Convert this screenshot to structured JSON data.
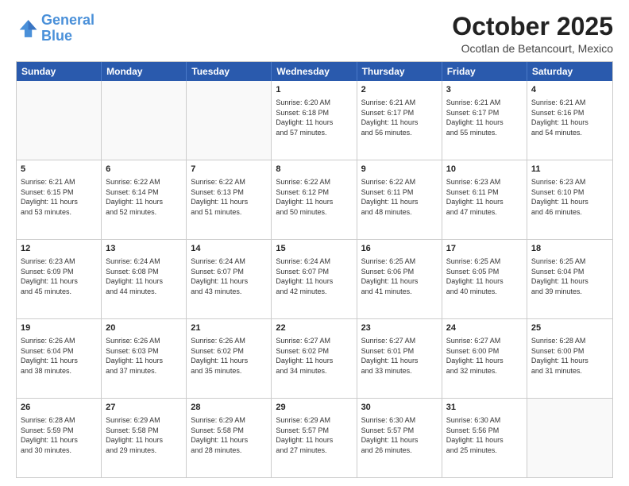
{
  "header": {
    "logo": {
      "line1": "General",
      "line2": "Blue"
    },
    "title": "October 2025",
    "subtitle": "Ocotlan de Betancourt, Mexico"
  },
  "weekdays": [
    "Sunday",
    "Monday",
    "Tuesday",
    "Wednesday",
    "Thursday",
    "Friday",
    "Saturday"
  ],
  "rows": [
    [
      {
        "day": "",
        "info": ""
      },
      {
        "day": "",
        "info": ""
      },
      {
        "day": "",
        "info": ""
      },
      {
        "day": "1",
        "info": "Sunrise: 6:20 AM\nSunset: 6:18 PM\nDaylight: 11 hours\nand 57 minutes."
      },
      {
        "day": "2",
        "info": "Sunrise: 6:21 AM\nSunset: 6:17 PM\nDaylight: 11 hours\nand 56 minutes."
      },
      {
        "day": "3",
        "info": "Sunrise: 6:21 AM\nSunset: 6:17 PM\nDaylight: 11 hours\nand 55 minutes."
      },
      {
        "day": "4",
        "info": "Sunrise: 6:21 AM\nSunset: 6:16 PM\nDaylight: 11 hours\nand 54 minutes."
      }
    ],
    [
      {
        "day": "5",
        "info": "Sunrise: 6:21 AM\nSunset: 6:15 PM\nDaylight: 11 hours\nand 53 minutes."
      },
      {
        "day": "6",
        "info": "Sunrise: 6:22 AM\nSunset: 6:14 PM\nDaylight: 11 hours\nand 52 minutes."
      },
      {
        "day": "7",
        "info": "Sunrise: 6:22 AM\nSunset: 6:13 PM\nDaylight: 11 hours\nand 51 minutes."
      },
      {
        "day": "8",
        "info": "Sunrise: 6:22 AM\nSunset: 6:12 PM\nDaylight: 11 hours\nand 50 minutes."
      },
      {
        "day": "9",
        "info": "Sunrise: 6:22 AM\nSunset: 6:11 PM\nDaylight: 11 hours\nand 48 minutes."
      },
      {
        "day": "10",
        "info": "Sunrise: 6:23 AM\nSunset: 6:11 PM\nDaylight: 11 hours\nand 47 minutes."
      },
      {
        "day": "11",
        "info": "Sunrise: 6:23 AM\nSunset: 6:10 PM\nDaylight: 11 hours\nand 46 minutes."
      }
    ],
    [
      {
        "day": "12",
        "info": "Sunrise: 6:23 AM\nSunset: 6:09 PM\nDaylight: 11 hours\nand 45 minutes."
      },
      {
        "day": "13",
        "info": "Sunrise: 6:24 AM\nSunset: 6:08 PM\nDaylight: 11 hours\nand 44 minutes."
      },
      {
        "day": "14",
        "info": "Sunrise: 6:24 AM\nSunset: 6:07 PM\nDaylight: 11 hours\nand 43 minutes."
      },
      {
        "day": "15",
        "info": "Sunrise: 6:24 AM\nSunset: 6:07 PM\nDaylight: 11 hours\nand 42 minutes."
      },
      {
        "day": "16",
        "info": "Sunrise: 6:25 AM\nSunset: 6:06 PM\nDaylight: 11 hours\nand 41 minutes."
      },
      {
        "day": "17",
        "info": "Sunrise: 6:25 AM\nSunset: 6:05 PM\nDaylight: 11 hours\nand 40 minutes."
      },
      {
        "day": "18",
        "info": "Sunrise: 6:25 AM\nSunset: 6:04 PM\nDaylight: 11 hours\nand 39 minutes."
      }
    ],
    [
      {
        "day": "19",
        "info": "Sunrise: 6:26 AM\nSunset: 6:04 PM\nDaylight: 11 hours\nand 38 minutes."
      },
      {
        "day": "20",
        "info": "Sunrise: 6:26 AM\nSunset: 6:03 PM\nDaylight: 11 hours\nand 37 minutes."
      },
      {
        "day": "21",
        "info": "Sunrise: 6:26 AM\nSunset: 6:02 PM\nDaylight: 11 hours\nand 35 minutes."
      },
      {
        "day": "22",
        "info": "Sunrise: 6:27 AM\nSunset: 6:02 PM\nDaylight: 11 hours\nand 34 minutes."
      },
      {
        "day": "23",
        "info": "Sunrise: 6:27 AM\nSunset: 6:01 PM\nDaylight: 11 hours\nand 33 minutes."
      },
      {
        "day": "24",
        "info": "Sunrise: 6:27 AM\nSunset: 6:00 PM\nDaylight: 11 hours\nand 32 minutes."
      },
      {
        "day": "25",
        "info": "Sunrise: 6:28 AM\nSunset: 6:00 PM\nDaylight: 11 hours\nand 31 minutes."
      }
    ],
    [
      {
        "day": "26",
        "info": "Sunrise: 6:28 AM\nSunset: 5:59 PM\nDaylight: 11 hours\nand 30 minutes."
      },
      {
        "day": "27",
        "info": "Sunrise: 6:29 AM\nSunset: 5:58 PM\nDaylight: 11 hours\nand 29 minutes."
      },
      {
        "day": "28",
        "info": "Sunrise: 6:29 AM\nSunset: 5:58 PM\nDaylight: 11 hours\nand 28 minutes."
      },
      {
        "day": "29",
        "info": "Sunrise: 6:29 AM\nSunset: 5:57 PM\nDaylight: 11 hours\nand 27 minutes."
      },
      {
        "day": "30",
        "info": "Sunrise: 6:30 AM\nSunset: 5:57 PM\nDaylight: 11 hours\nand 26 minutes."
      },
      {
        "day": "31",
        "info": "Sunrise: 6:30 AM\nSunset: 5:56 PM\nDaylight: 11 hours\nand 25 minutes."
      },
      {
        "day": "",
        "info": ""
      }
    ]
  ]
}
